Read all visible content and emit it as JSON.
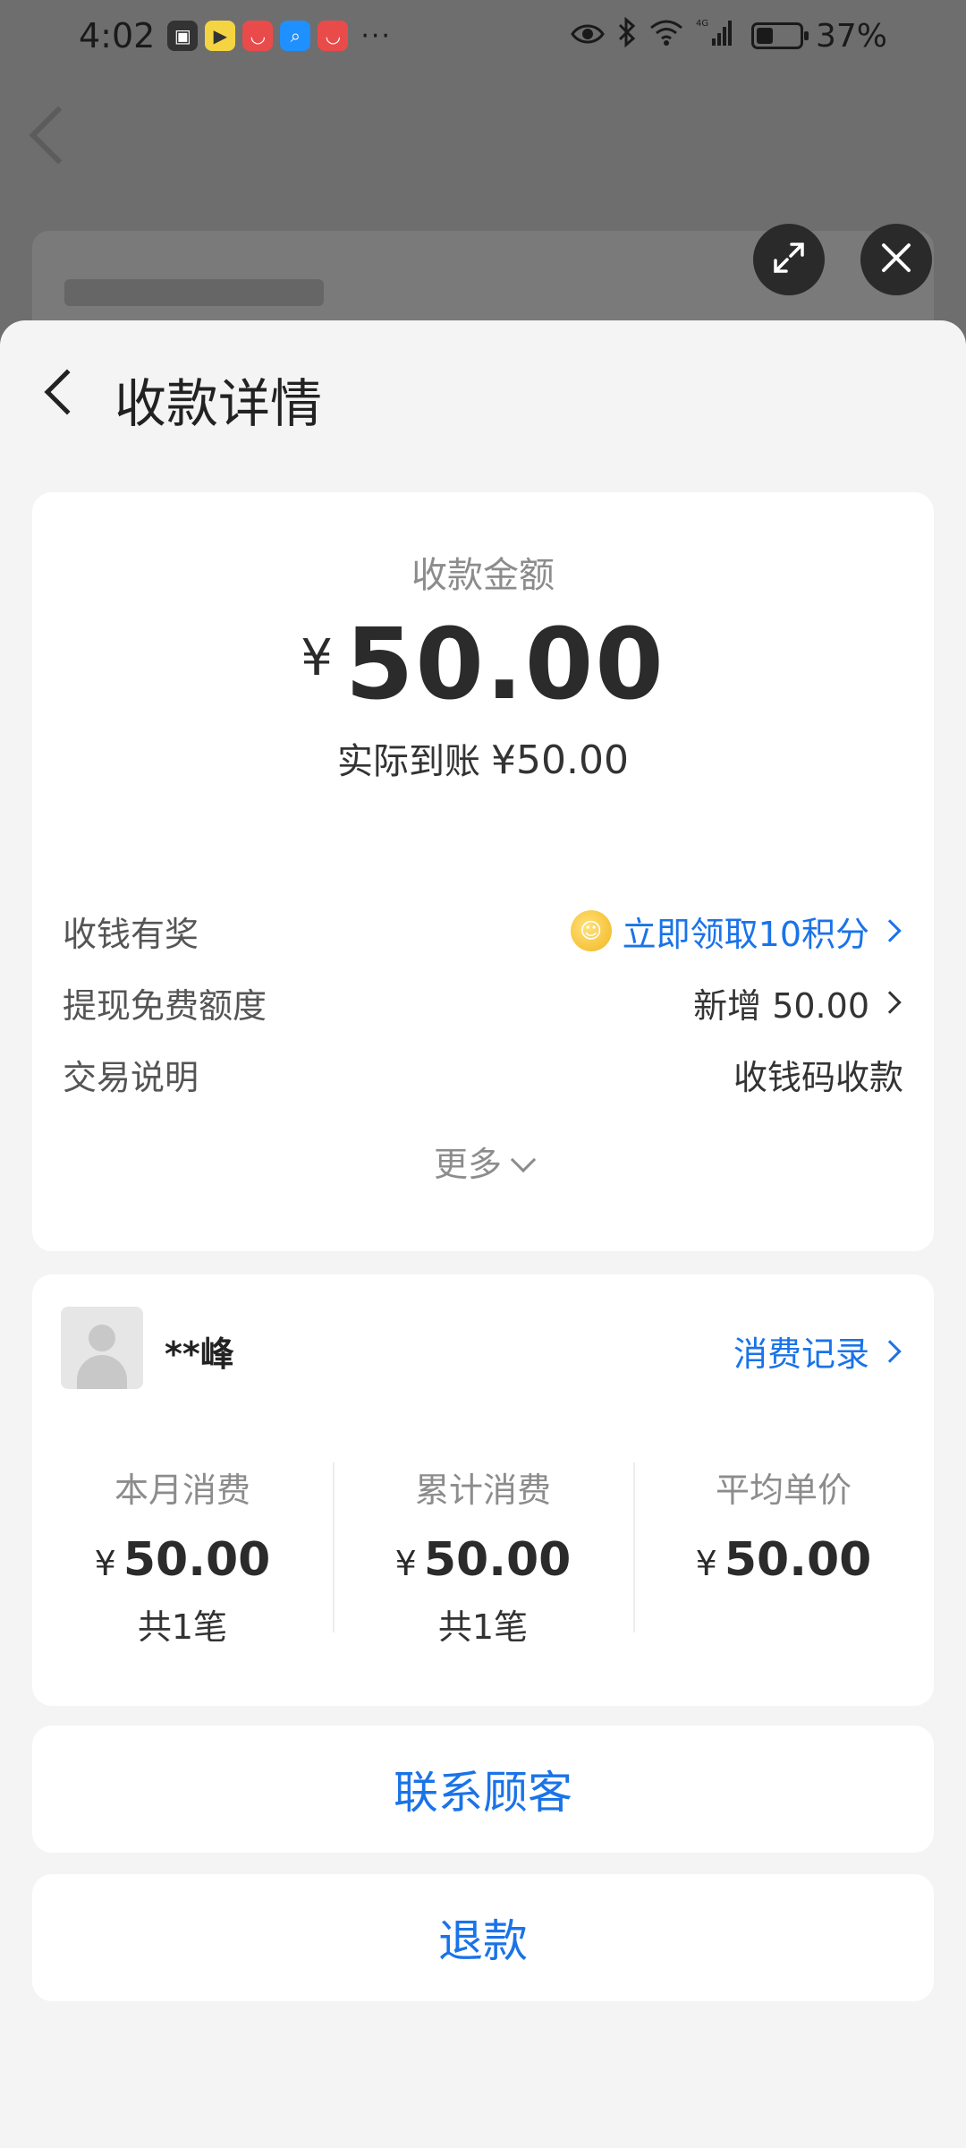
{
  "status_bar": {
    "time": "4:02",
    "dots": "···",
    "battery_percent": "37%",
    "network": "4G"
  },
  "sheet": {
    "title": "收款详情"
  },
  "amount_card": {
    "label": "收款金额",
    "currency": "¥",
    "amount": "50.00",
    "received_label": "实际到账",
    "received_value": "¥50.00",
    "rows": [
      {
        "label": "收钱有奖",
        "value": "立即领取10积分"
      },
      {
        "label": "提现免费额度",
        "value": "新增 50.00"
      },
      {
        "label": "交易说明",
        "value": "收钱码收款"
      }
    ],
    "more_label": "更多"
  },
  "customer_card": {
    "name": "**峰",
    "records_link": "消费记录",
    "stats": [
      {
        "label": "本月消费",
        "currency": "¥",
        "value": "50.00",
        "count": "共1笔"
      },
      {
        "label": "累计消费",
        "currency": "¥",
        "value": "50.00",
        "count": "共1笔"
      },
      {
        "label": "平均单价",
        "currency": "¥",
        "value": "50.00",
        "count": ""
      }
    ]
  },
  "actions": {
    "contact_label": "联系顾客",
    "refund_label": "退款"
  },
  "colors": {
    "accent": "#1a73e8",
    "sheet_bg": "#f4f4f4",
    "card_bg": "#ffffff"
  }
}
